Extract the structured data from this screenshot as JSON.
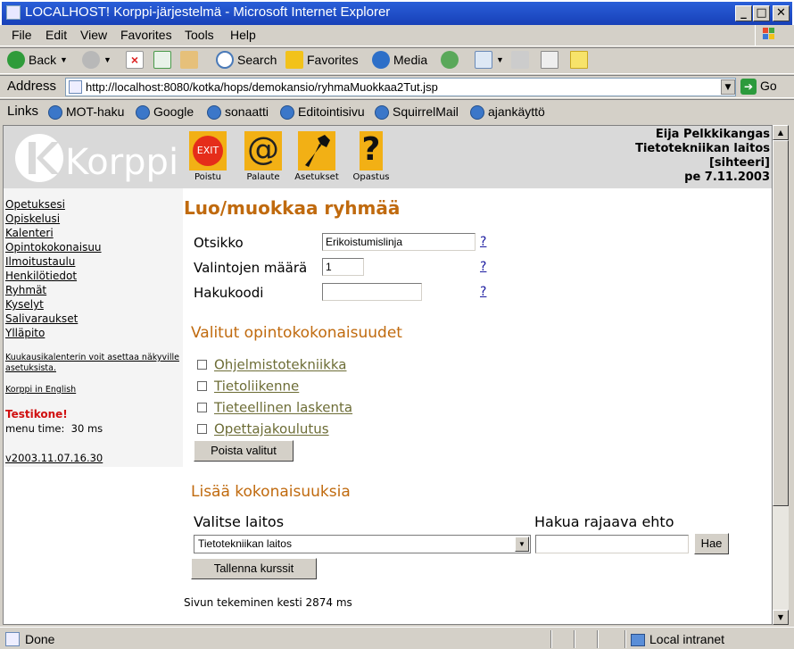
{
  "window": {
    "title": "LOCALHOST! Korppi-järjestelmä - Microsoft Internet Explorer",
    "buttons": {
      "minimize": "_",
      "maximize": "□",
      "close": "✕"
    }
  },
  "menubar": [
    "File",
    "Edit",
    "View",
    "Favorites",
    "Tools",
    "Help"
  ],
  "toolbar": {
    "back": "Back",
    "search": "Search",
    "favorites": "Favorites",
    "media": "Media"
  },
  "address": {
    "label": "Address",
    "url": "http://localhost:8080/kotka/hops/demokansio/ryhmaMuokkaa2Tut.jsp",
    "go": "Go"
  },
  "links": {
    "label": "Links",
    "items": [
      "MOT-haku",
      "Google",
      "sonaatti",
      "Editointisivu",
      "SquirrelMail",
      "ajankäyttö"
    ]
  },
  "header": {
    "logo_text": "Korppi",
    "icons": [
      {
        "label": "Poistu",
        "glyph": "EXIT"
      },
      {
        "label": "Palaute",
        "glyph": "@"
      },
      {
        "label": "Asetukset",
        "glyph": "wrench"
      },
      {
        "label": "Opastus",
        "glyph": "?"
      }
    ],
    "user": {
      "name": "Eija Pelkkikangas",
      "dept": "Tietotekniikan laitos",
      "role": "[sihteeri]",
      "date": "pe 7.11.2003"
    }
  },
  "leftnav": {
    "items": [
      "Opetuksesi",
      "Opiskelusi",
      "Kalenteri",
      "Opintokokonaisuu",
      "Ilmoitustaulu",
      "Henkilötiedot",
      "Ryhmät",
      "Kyselyt",
      "Salivaraukset",
      "Ylläpito"
    ],
    "calendar_note": "Kuukausikalenterin voit asettaa näkyville asetuksista.",
    "english_link": "Korppi in English",
    "test_label": "Testikone!",
    "menu_time": "menu time:  30 ms",
    "version": "v2003.11.07.16.30"
  },
  "form": {
    "heading": "Luo/muokkaa ryhmää",
    "fields": [
      {
        "label": "Otsikko",
        "value": "Erikoistumislinja"
      },
      {
        "label": "Valintojen määrä",
        "value": "1"
      },
      {
        "label": "Hakukoodi",
        "value": ""
      }
    ],
    "help": "?",
    "selected_heading": "Valitut opintokokonaisuudet",
    "selected_items": [
      "Ohjelmistotekniikka",
      "Tietoliikenne",
      "Tieteellinen laskenta",
      "Opettajakoulutus"
    ],
    "remove_button": "Poista valitut",
    "add_heading": "Lisää kokonaisuuksia",
    "dept_label": "Valitse laitos",
    "filter_label": "Hakua rajaava ehto",
    "dept_value": "Tietotekniikan laitos",
    "filter_value": "",
    "search_button": "Hae",
    "save_button": "Tallenna kurssit",
    "footer": "Sivun tekeminen kesti 2874 ms"
  },
  "status": {
    "text": "Done",
    "zone": "Local intranet"
  }
}
